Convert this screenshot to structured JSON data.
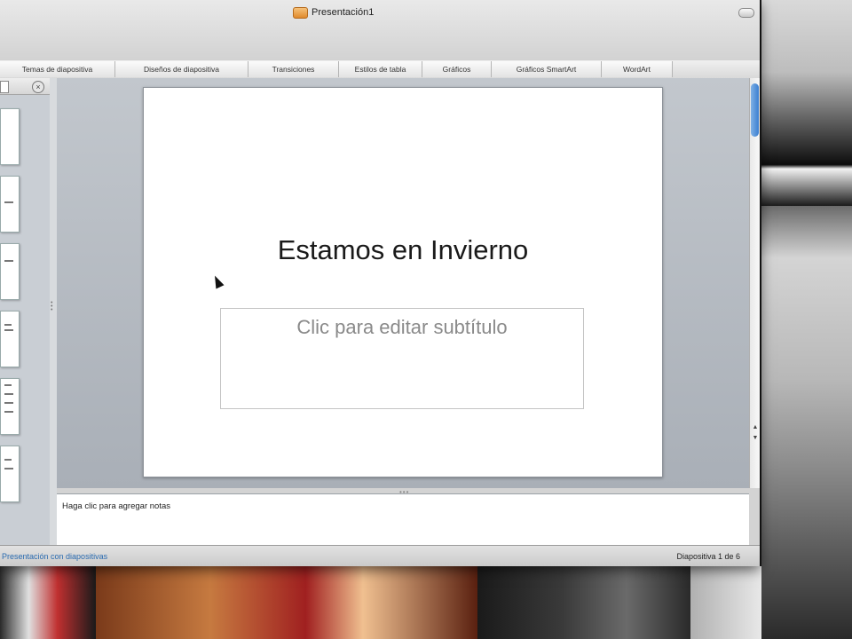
{
  "window": {
    "title": "Presentación1"
  },
  "ribbon": {
    "tabs": [
      {
        "label": "Temas de diapositiva"
      },
      {
        "label": "Diseños de diapositiva"
      },
      {
        "label": "Transiciones"
      },
      {
        "label": "Estilos de tabla"
      },
      {
        "label": "Gráficos"
      },
      {
        "label": "Gráficos SmartArt"
      },
      {
        "label": "WordArt"
      }
    ]
  },
  "slide": {
    "title": "Estamos en Invierno",
    "subtitle_placeholder": "Clic para editar subtítulo"
  },
  "notes": {
    "placeholder": "Haga clic para agregar notas"
  },
  "status": {
    "view_label": "Presentación con diapositivas",
    "slide_counter": "Diapositiva 1 de 6"
  },
  "pane": {
    "close_glyph": "×"
  },
  "scroll": {
    "up_glyph": "▲",
    "down_glyph": "▼"
  },
  "colors": {
    "accent_blue": "#3a7ed0",
    "status_link": "#2a6bb0"
  }
}
